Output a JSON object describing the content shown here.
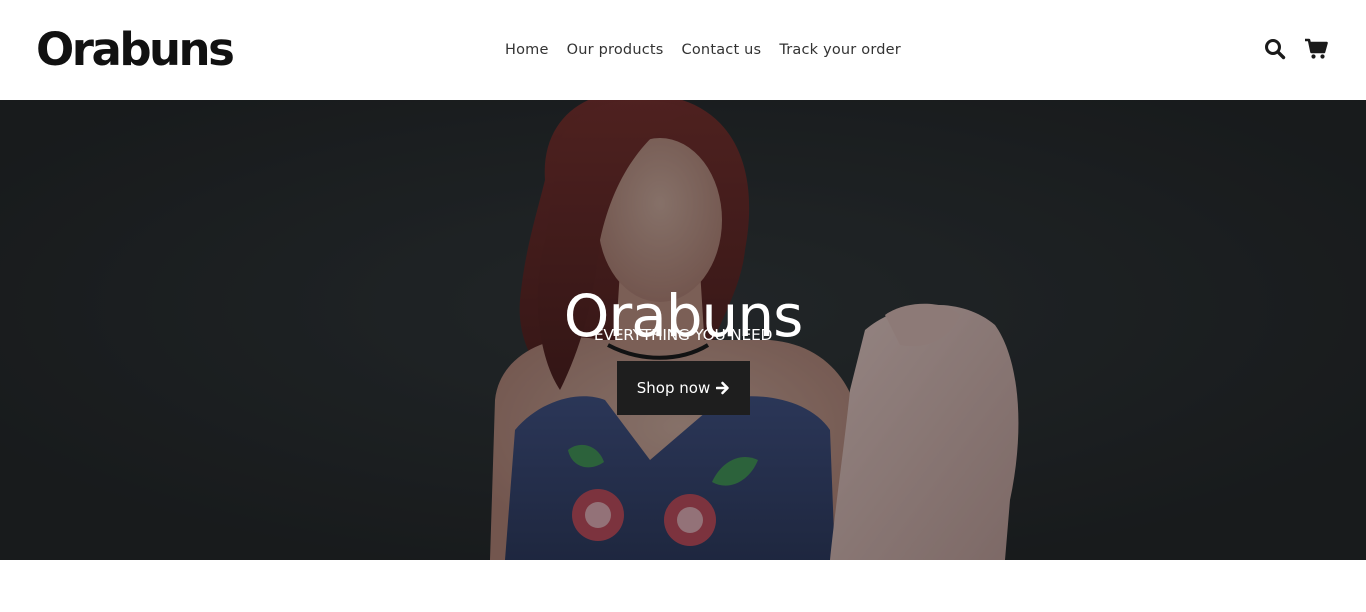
{
  "header": {
    "logo": "Orabuns",
    "nav": [
      {
        "label": "Home"
      },
      {
        "label": "Our products"
      },
      {
        "label": "Contact us"
      },
      {
        "label": "Track your order"
      }
    ],
    "icons": [
      "search-icon",
      "cart-icon"
    ]
  },
  "hero": {
    "title": "Orabuns",
    "subtitle": "EVERYTHING YOU NEED",
    "cta_label": "Shop now",
    "cta_icon": "arrow-right-icon"
  },
  "colors": {
    "text_dark": "#111111",
    "hero_bg": "#1f2324",
    "button_bg": "#1e1e1e"
  }
}
